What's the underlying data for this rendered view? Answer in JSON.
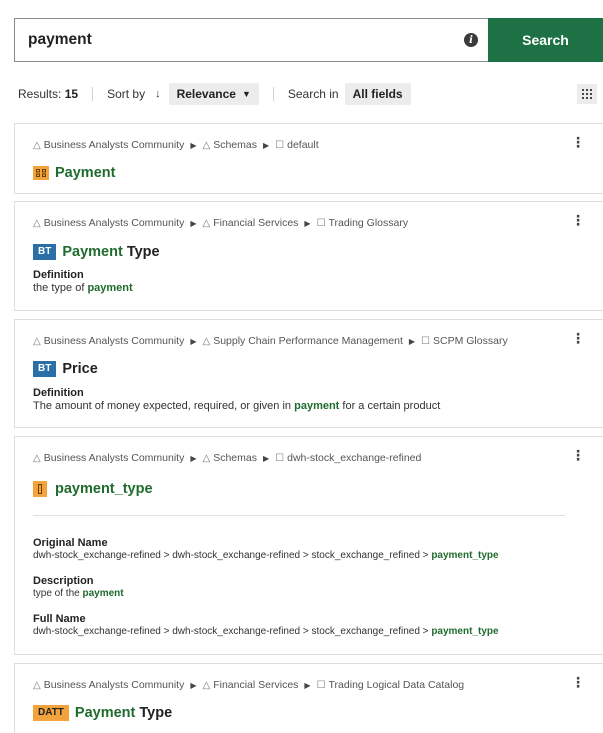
{
  "search": {
    "value": "payment",
    "button_label": "Search"
  },
  "toolbar": {
    "results_label": "Results:",
    "results_count": "15",
    "sort_label": "Sort by",
    "sort_value": "Relevance",
    "search_in_label": "Search in",
    "search_in_value": "All fields"
  },
  "results": [
    {
      "crumbs": [
        "Business Analysts Community",
        "Schemas",
        "default"
      ],
      "title_hl": "Payment",
      "title_rest": ""
    },
    {
      "crumbs": [
        "Business Analysts Community",
        "Financial Services",
        "Trading Glossary"
      ],
      "badge": "BT",
      "title_hl": "Payment",
      "title_rest": " Type",
      "def_label": "Definition",
      "def_pre": "the type of ",
      "def_hl": "payment",
      "def_post": ""
    },
    {
      "crumbs": [
        "Business Analysts Community",
        "Supply Chain Performance Management",
        "SCPM Glossary"
      ],
      "badge": "BT",
      "title_hl": "",
      "title_rest": "Price",
      "def_label": "Definition",
      "def_pre": "The amount of money expected, required, or given in ",
      "def_hl": "payment",
      "def_post": " for a certain product"
    },
    {
      "crumbs": [
        "Business Analysts Community",
        "Schemas",
        "dwh-stock_exchange-refined"
      ],
      "title_hl": "payment_type",
      "title_rest": "",
      "orig_label": "Original Name",
      "orig_pre": "dwh-stock_exchange-refined > dwh-stock_exchange-refined > stock_exchange_refined > ",
      "orig_hl": "payment_type",
      "desc_label": "Description",
      "desc_pre": "type of the ",
      "desc_hl": "payment",
      "full_label": "Full Name",
      "full_pre": "dwh-stock_exchange-refined > dwh-stock_exchange-refined > stock_exchange_refined > ",
      "full_hl": "payment_type"
    },
    {
      "crumbs": [
        "Business Analysts Community",
        "Financial Services",
        "Trading Logical Data Catalog"
      ],
      "badge": "DATT",
      "title_hl": "Payment",
      "title_rest": " Type"
    }
  ],
  "colors": {
    "accent": "#1e7145",
    "highlight": "#1f6b2d",
    "badge_bt": "#2a6fa8",
    "badge_orange": "#f2a33c"
  }
}
